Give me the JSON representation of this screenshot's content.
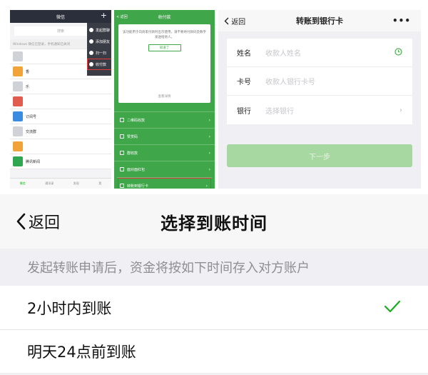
{
  "panel1": {
    "title": "微信",
    "plus": "+",
    "search_placeholder": "搜索",
    "banner": "Windows 微信已登录，手机通知已关闭",
    "chats": [
      {
        "name": ""
      },
      {
        "name": "香"
      },
      {
        "name": "乐"
      },
      {
        "name": ""
      },
      {
        "name": "订阅号"
      },
      {
        "name": "交流群"
      },
      {
        "name": ""
      },
      {
        "name": "腾讯新闻"
      }
    ],
    "menu": [
      "发起群聊",
      "添加朋友",
      "扫一扫",
      "收付款"
    ],
    "tabs": [
      "微信",
      "通讯录",
      "发现",
      "我"
    ]
  },
  "panel2": {
    "back": "返回",
    "title": "收付款",
    "notice": "该功能用于向商家付款时出示使用，请不要将付款码及数字发送给他人。",
    "confirm": "知道了",
    "more": "查看详情",
    "items": [
      {
        "label": "二维码收款"
      },
      {
        "label": "赞赏码"
      },
      {
        "label": "群收款"
      },
      {
        "label": "面对面红包"
      },
      {
        "label": "转账到银行卡"
      }
    ]
  },
  "panel3": {
    "back": "返回",
    "title": "转账到银行卡",
    "more": "•••",
    "fields": [
      {
        "label": "姓名",
        "placeholder": "收款人姓名"
      },
      {
        "label": "卡号",
        "placeholder": "收款人银行卡号"
      },
      {
        "label": "银行",
        "placeholder": "选择银行"
      }
    ],
    "next": "下一步"
  },
  "arrival": {
    "back": "返回",
    "title": "选择到账时间",
    "hint": "发起转账申请后，资金将按如下时间存入对方账户",
    "options": [
      {
        "label": "2小时内到账",
        "selected": true
      },
      {
        "label": "明天24点前到账",
        "selected": false
      }
    ],
    "accent": "#1aad19"
  }
}
